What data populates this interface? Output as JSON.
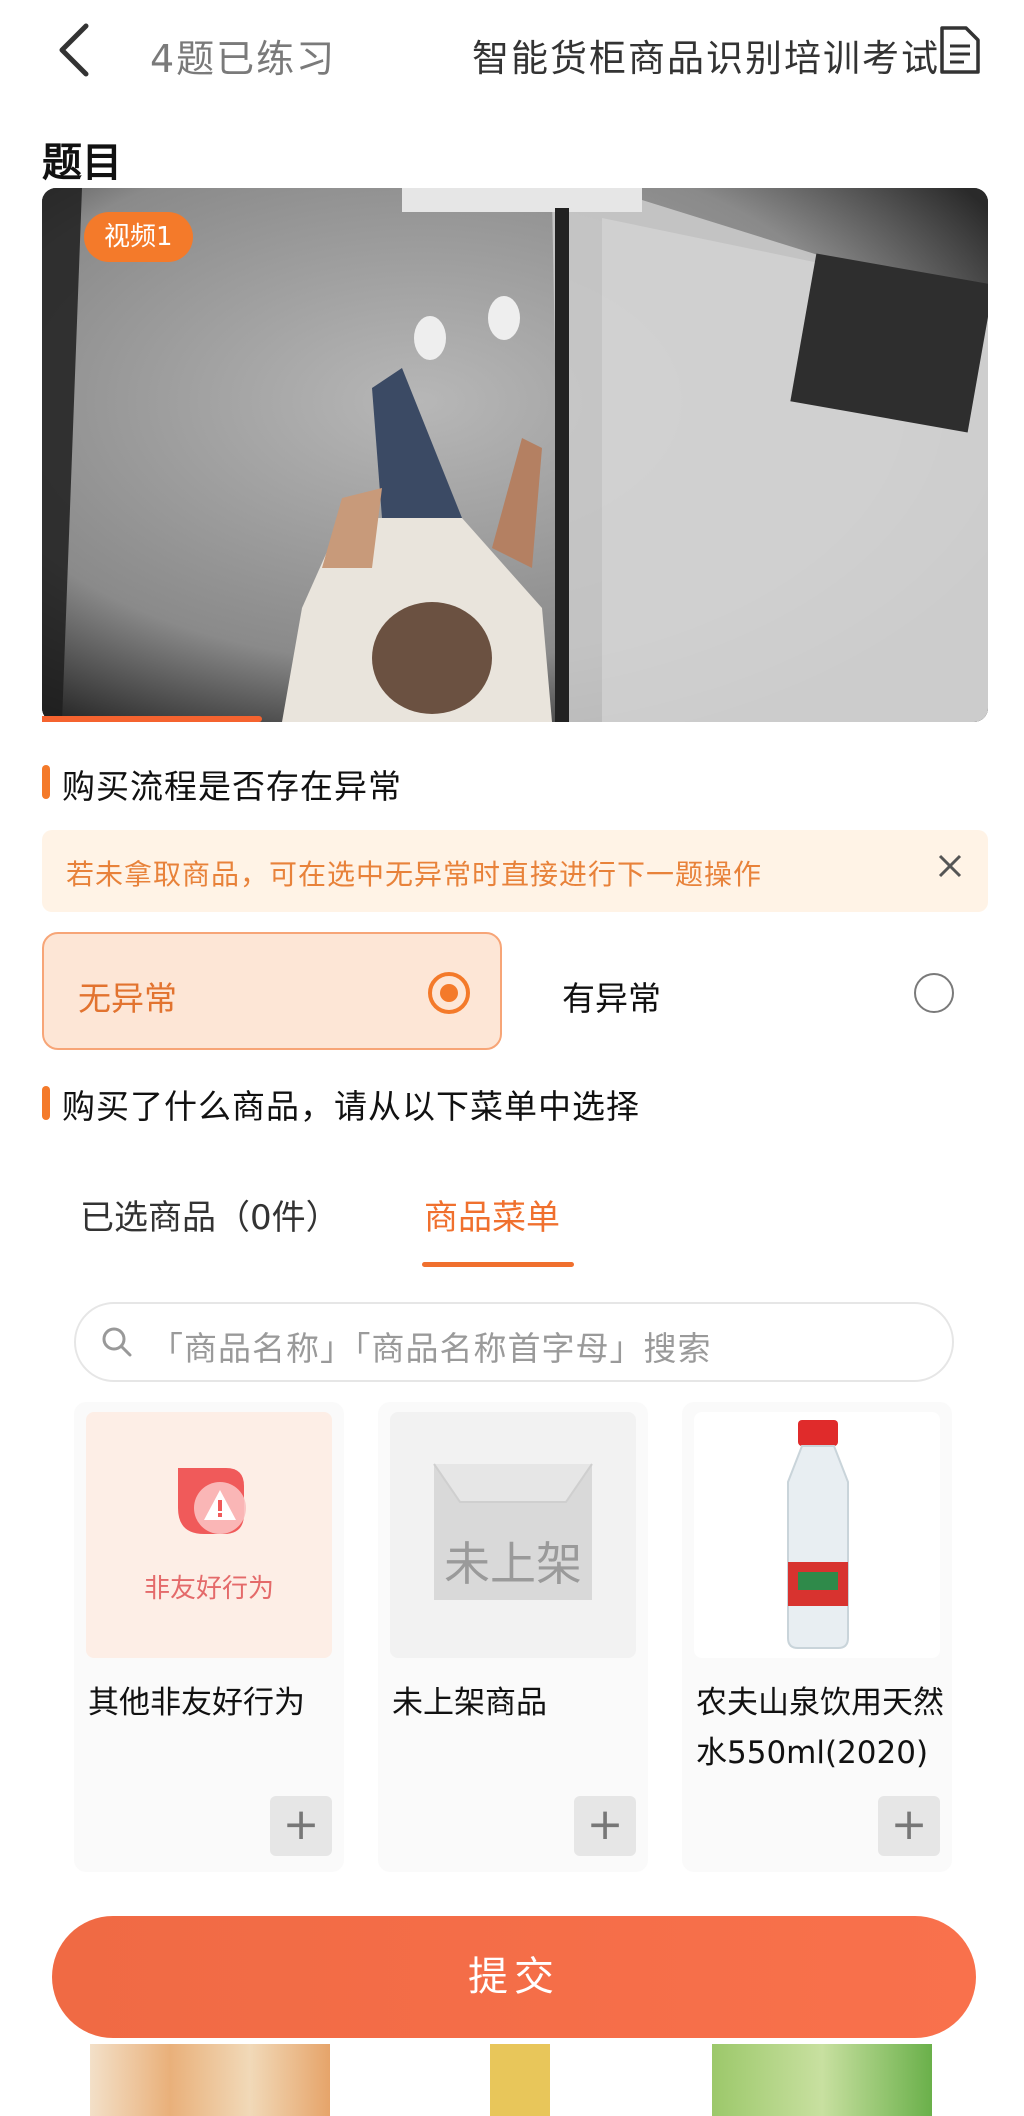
{
  "header": {
    "progress": "4题已练习",
    "exam_title": "智能货柜商品识别培训考试"
  },
  "section_title": "题目",
  "video": {
    "badge": "视频1"
  },
  "question1": {
    "title": "购买流程是否存在异常",
    "notice": "若未拿取商品，可在选中无异常时直接进行下一题操作",
    "options": [
      {
        "label": "无异常",
        "selected": true
      },
      {
        "label": "有异常",
        "selected": false
      }
    ]
  },
  "question2": {
    "title": "购买了什么商品，请从以下菜单中选择"
  },
  "tabs": [
    {
      "label": "已选商品（0件）",
      "active": false
    },
    {
      "label": "商品菜单",
      "active": true
    }
  ],
  "search": {
    "placeholder": "「商品名称」「商品名称首字母」搜索"
  },
  "products": [
    {
      "name": "其他非友好行为",
      "image_text": "非友好行为",
      "icon": "warning-icon"
    },
    {
      "name": "未上架商品",
      "image_text": "未上架",
      "icon": "empty-box-icon"
    },
    {
      "name": "农夫山泉饮用天然水550ml(2020)",
      "image_text": "",
      "icon": "water-bottle-image"
    }
  ],
  "submit_label": "提交",
  "colors": {
    "accent": "#f47a2a",
    "submit": "#f06a44"
  }
}
